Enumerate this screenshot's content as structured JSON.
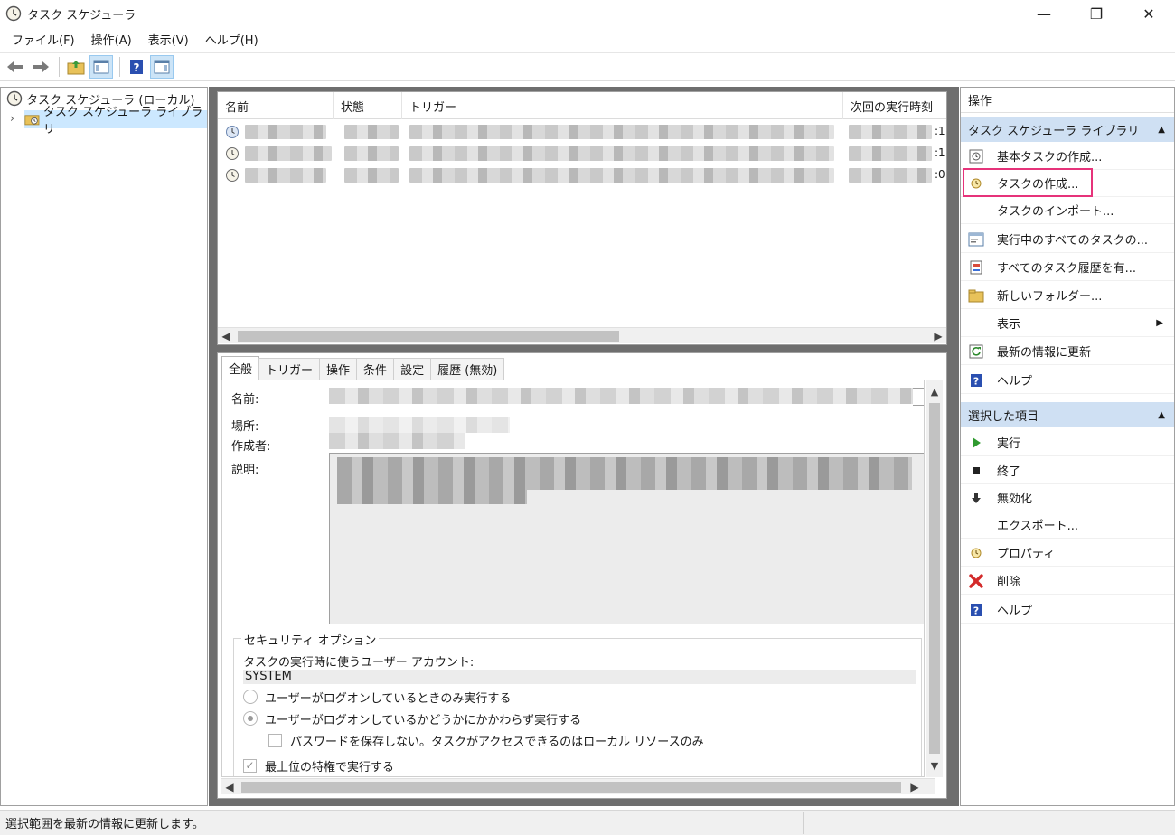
{
  "window": {
    "title": "タスク スケジューラ",
    "minimize": "—",
    "restore": "❐",
    "close": "✕"
  },
  "menu": [
    "ファイル(F)",
    "操作(A)",
    "表示(V)",
    "ヘルプ(H)"
  ],
  "tree": {
    "root": "タスク スケジューラ (ローカル)",
    "library": "タスク スケジューラ ライブラリ",
    "expander": "›"
  },
  "list": {
    "columns": [
      "名前",
      "状態",
      "トリガー",
      "次回の実行時刻"
    ],
    "row_suffixes": [
      ":1",
      ":1",
      ":0"
    ]
  },
  "detail": {
    "tabs": [
      "全般",
      "トリガー",
      "操作",
      "条件",
      "設定",
      "履歴 (無効)"
    ],
    "labels": {
      "name": "名前:",
      "location": "場所:",
      "author": "作成者:",
      "description": "説明:"
    },
    "security": {
      "legend": "セキュリティ オプション",
      "account_label": "タスクの実行時に使うユーザー アカウント:",
      "account": "SYSTEM",
      "radio_logged_on": "ユーザーがログオンしているときのみ実行する",
      "radio_whether": "ユーザーがログオンしているかどうかにかかわらず実行する",
      "no_password": "パスワードを保存しない。タスクがアクセスできるのはローカル リソースのみ",
      "highest": "最上位の特権で実行する"
    }
  },
  "actions": {
    "title": "操作",
    "section_library": "タスク スケジューラ ライブラリ",
    "library_items": [
      "基本タスクの作成...",
      "タスクの作成...",
      "タスクのインポート...",
      "実行中のすべてのタスクの...",
      "すべてのタスク履歴を有...",
      "新しいフォルダー...",
      "表示",
      "最新の情報に更新",
      "ヘルプ"
    ],
    "section_selected": "選択した項目",
    "selected_items": [
      "実行",
      "終了",
      "無効化",
      "エクスポート...",
      "プロパティ",
      "削除",
      "ヘルプ"
    ]
  },
  "status": "選択範囲を最新の情報に更新します。",
  "colors": {
    "accent_header": "#cfe0f3",
    "highlight": "#e6337a",
    "selection": "#cce8ff"
  }
}
